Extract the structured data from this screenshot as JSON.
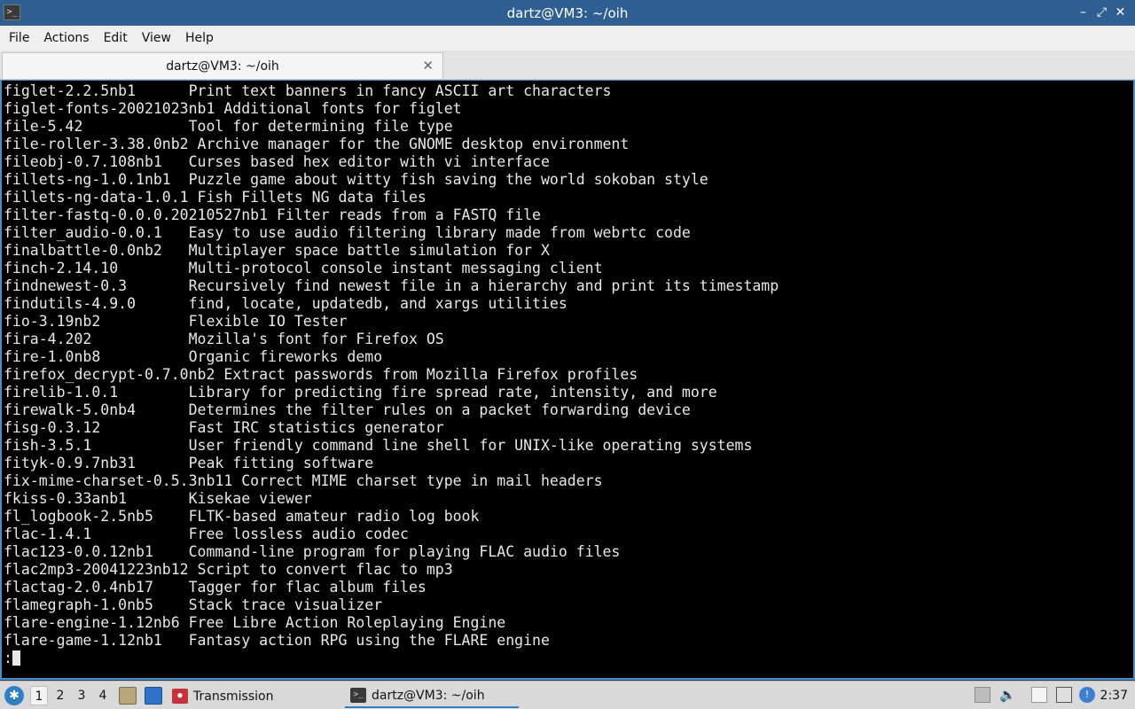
{
  "window": {
    "title": "dartz@VM3: ~/oih",
    "icon": "terminal-icon",
    "controls": {
      "minimize": "minimize-icon",
      "maximize": "maximize-icon",
      "close": "close-icon"
    }
  },
  "menubar": {
    "items": [
      "File",
      "Actions",
      "Edit",
      "View",
      "Help"
    ]
  },
  "tabs": [
    {
      "label": "dartz@VM3: ~/oih",
      "close_icon": "close-icon"
    }
  ],
  "terminal": {
    "lines": [
      "figlet-2.2.5nb1      Print text banners in fancy ASCII art characters",
      "figlet-fonts-20021023nb1 Additional fonts for figlet",
      "file-5.42            Tool for determining file type",
      "file-roller-3.38.0nb2 Archive manager for the GNOME desktop environment",
      "fileobj-0.7.108nb1   Curses based hex editor with vi interface",
      "fillets-ng-1.0.1nb1  Puzzle game about witty fish saving the world sokoban style",
      "fillets-ng-data-1.0.1 Fish Fillets NG data files",
      "filter-fastq-0.0.0.20210527nb1 Filter reads from a FASTQ file",
      "filter_audio-0.0.1   Easy to use audio filtering library made from webrtc code",
      "finalbattle-0.0nb2   Multiplayer space battle simulation for X",
      "finch-2.14.10        Multi-protocol console instant messaging client",
      "findnewest-0.3       Recursively find newest file in a hierarchy and print its timestamp",
      "findutils-4.9.0      find, locate, updatedb, and xargs utilities",
      "fio-3.19nb2          Flexible IO Tester",
      "fira-4.202           Mozilla's font for Firefox OS",
      "fire-1.0nb8          Organic fireworks demo",
      "firefox_decrypt-0.7.0nb2 Extract passwords from Mozilla Firefox profiles",
      "firelib-1.0.1        Library for predicting fire spread rate, intensity, and more",
      "firewalk-5.0nb4      Determines the filter rules on a packet forwarding device",
      "fisg-0.3.12          Fast IRC statistics generator",
      "fish-3.5.1           User friendly command line shell for UNIX-like operating systems",
      "fityk-0.9.7nb31      Peak fitting software",
      "fix-mime-charset-0.5.3nb11 Correct MIME charset type in mail headers",
      "fkiss-0.33anb1       Kisekae viewer",
      "fl_logbook-2.5nb5    FLTK-based amateur radio log book",
      "flac-1.4.1           Free lossless audio codec",
      "flac123-0.0.12nb1    Command-line program for playing FLAC audio files",
      "flac2mp3-20041223nb12 Script to convert flac to mp3",
      "flactag-2.0.4nb17    Tagger for flac album files",
      "flamegraph-1.0nb5    Stack trace visualizer",
      "flare-engine-1.12nb6 Free Libre Action Roleplaying Engine",
      "flare-game-1.12nb1   Fantasy action RPG using the FLARE engine"
    ],
    "prompt": ":"
  },
  "taskbar": {
    "start_icon": "lxqt-start-icon",
    "workspaces": [
      "1",
      "2",
      "3",
      "4"
    ],
    "active_workspace": "1",
    "launchers": [
      "file-manager-icon",
      "window-icon"
    ],
    "tasks": [
      {
        "label": "Transmission",
        "icon": "transmission-icon"
      },
      {
        "label": "dartz@VM3: ~/oih",
        "icon": "terminal-icon"
      }
    ],
    "tray": [
      "removable-drive-icon",
      "volume-icon",
      "clipboard-icon",
      "display-icon",
      "update-notifier-icon"
    ],
    "clock": "2:37"
  },
  "colors": {
    "titlebar": "#2f5f92",
    "terminal_bg": "#000000",
    "terminal_fg": "#e8e8e8",
    "accent": "#4a8ec9"
  }
}
